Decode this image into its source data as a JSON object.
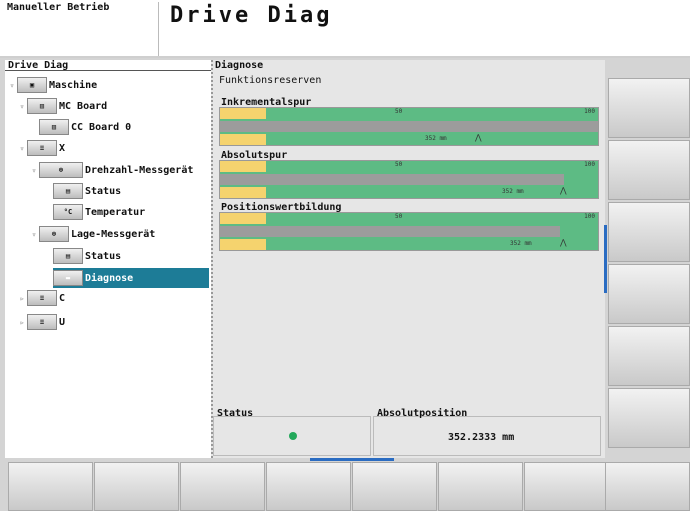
{
  "header": {
    "mode": "Manueller Betrieb",
    "title": "Drive Diag"
  },
  "tree": {
    "title": "Drive Diag",
    "nodes": [
      {
        "label": "Maschine",
        "icon": "machine-icon"
      },
      {
        "label": "MC Board",
        "icon": "board-icon"
      },
      {
        "label": "CC Board 0",
        "icon": "board-icon"
      },
      {
        "label": "X",
        "icon": "axis-icon"
      },
      {
        "label": "Drehzahl-Messgerät",
        "icon": "encoder-icon"
      },
      {
        "label": "Status",
        "icon": "status-icon"
      },
      {
        "label": "Temperatur",
        "icon": "thermometer-icon"
      },
      {
        "label": "Lage-Messgerät",
        "icon": "encoder-icon"
      },
      {
        "label": "Status",
        "icon": "status-icon"
      },
      {
        "label": "Diagnose",
        "icon": "diagnose-icon"
      },
      {
        "label": "C",
        "icon": "axis-icon"
      },
      {
        "label": "U",
        "icon": "axis-icon"
      }
    ]
  },
  "diag": {
    "title": "Diagnose",
    "subtitle": "Funktionsreserven",
    "tracks": [
      {
        "label": "Inkrementalspur",
        "scale_mid": "50",
        "scale_max": "100",
        "value_label": "352 mm",
        "fill": 1.0
      },
      {
        "label": "Absolutspur",
        "scale_mid": "50",
        "scale_max": "100",
        "value_label": "352 mm",
        "fill": 0.91
      },
      {
        "label": "Positionswertbildung",
        "scale_mid": "50",
        "scale_max": "100",
        "value_label": "352 mm",
        "fill": 0.9
      }
    ],
    "status_label": "Status",
    "status_color": "#22a85a",
    "abspos_label": "Absolutposition",
    "abspos_value": "352.2333 mm"
  },
  "colors": {
    "selected": "#1d7c97",
    "reserve": "#5dbb84",
    "yellow": "#f5d36e",
    "accent": "#2a6cc2"
  }
}
